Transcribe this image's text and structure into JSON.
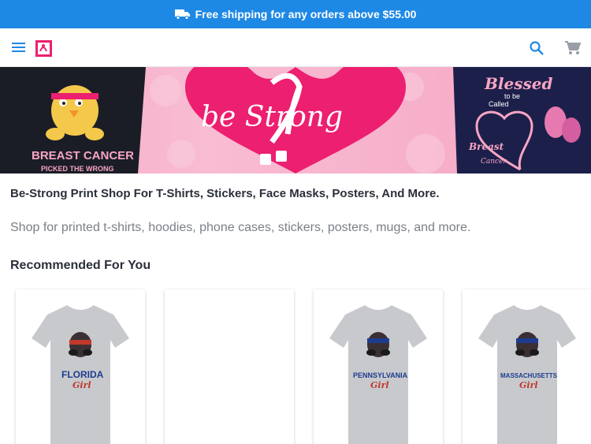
{
  "promo": {
    "text": "Free shipping for any orders above $55.00",
    "icon": "truck-icon"
  },
  "header": {
    "menu_icon": "hamburger-menu-icon",
    "logo": "brand-logo",
    "search_icon": "search-icon",
    "cart_icon": "shopping-cart-icon"
  },
  "banner": {
    "center_text": "be Strong",
    "left_shirt_text": "BREAST CANCER",
    "left_shirt_subtext": "PICKED THE WRONG",
    "right_shirt_text_1": "Blessed",
    "right_shirt_text_2": "to be",
    "right_shirt_text_3": "Called",
    "right_shirt_text_4": "Breast",
    "right_shirt_text_5": "Cancer"
  },
  "shop": {
    "title": "Be-Strong Print Shop For T-Shirts, Stickers, Face Masks, Posters, And More.",
    "description": "Shop for printed t-shirts, hoodies, phone cases, stickers, posters, mugs, and more."
  },
  "recommended": {
    "title": "Recommended For You",
    "products": [
      {
        "shirt_text": "FLORIDA",
        "sub_text": "Girl",
        "has_image": true
      },
      {
        "shirt_text": "",
        "sub_text": "",
        "has_image": false
      },
      {
        "shirt_text": "PENNSYLVANIA",
        "sub_text": "Girl",
        "has_image": true
      },
      {
        "shirt_text": "MASSACHUSETTS",
        "sub_text": "Girl",
        "has_image": true
      }
    ]
  },
  "colors": {
    "promo_bg": "#1e88e5",
    "accent_pink": "#ec1f70",
    "icon_blue": "#1e88e5",
    "text_dark": "#2b2f3a",
    "text_muted": "#7b7f88"
  }
}
